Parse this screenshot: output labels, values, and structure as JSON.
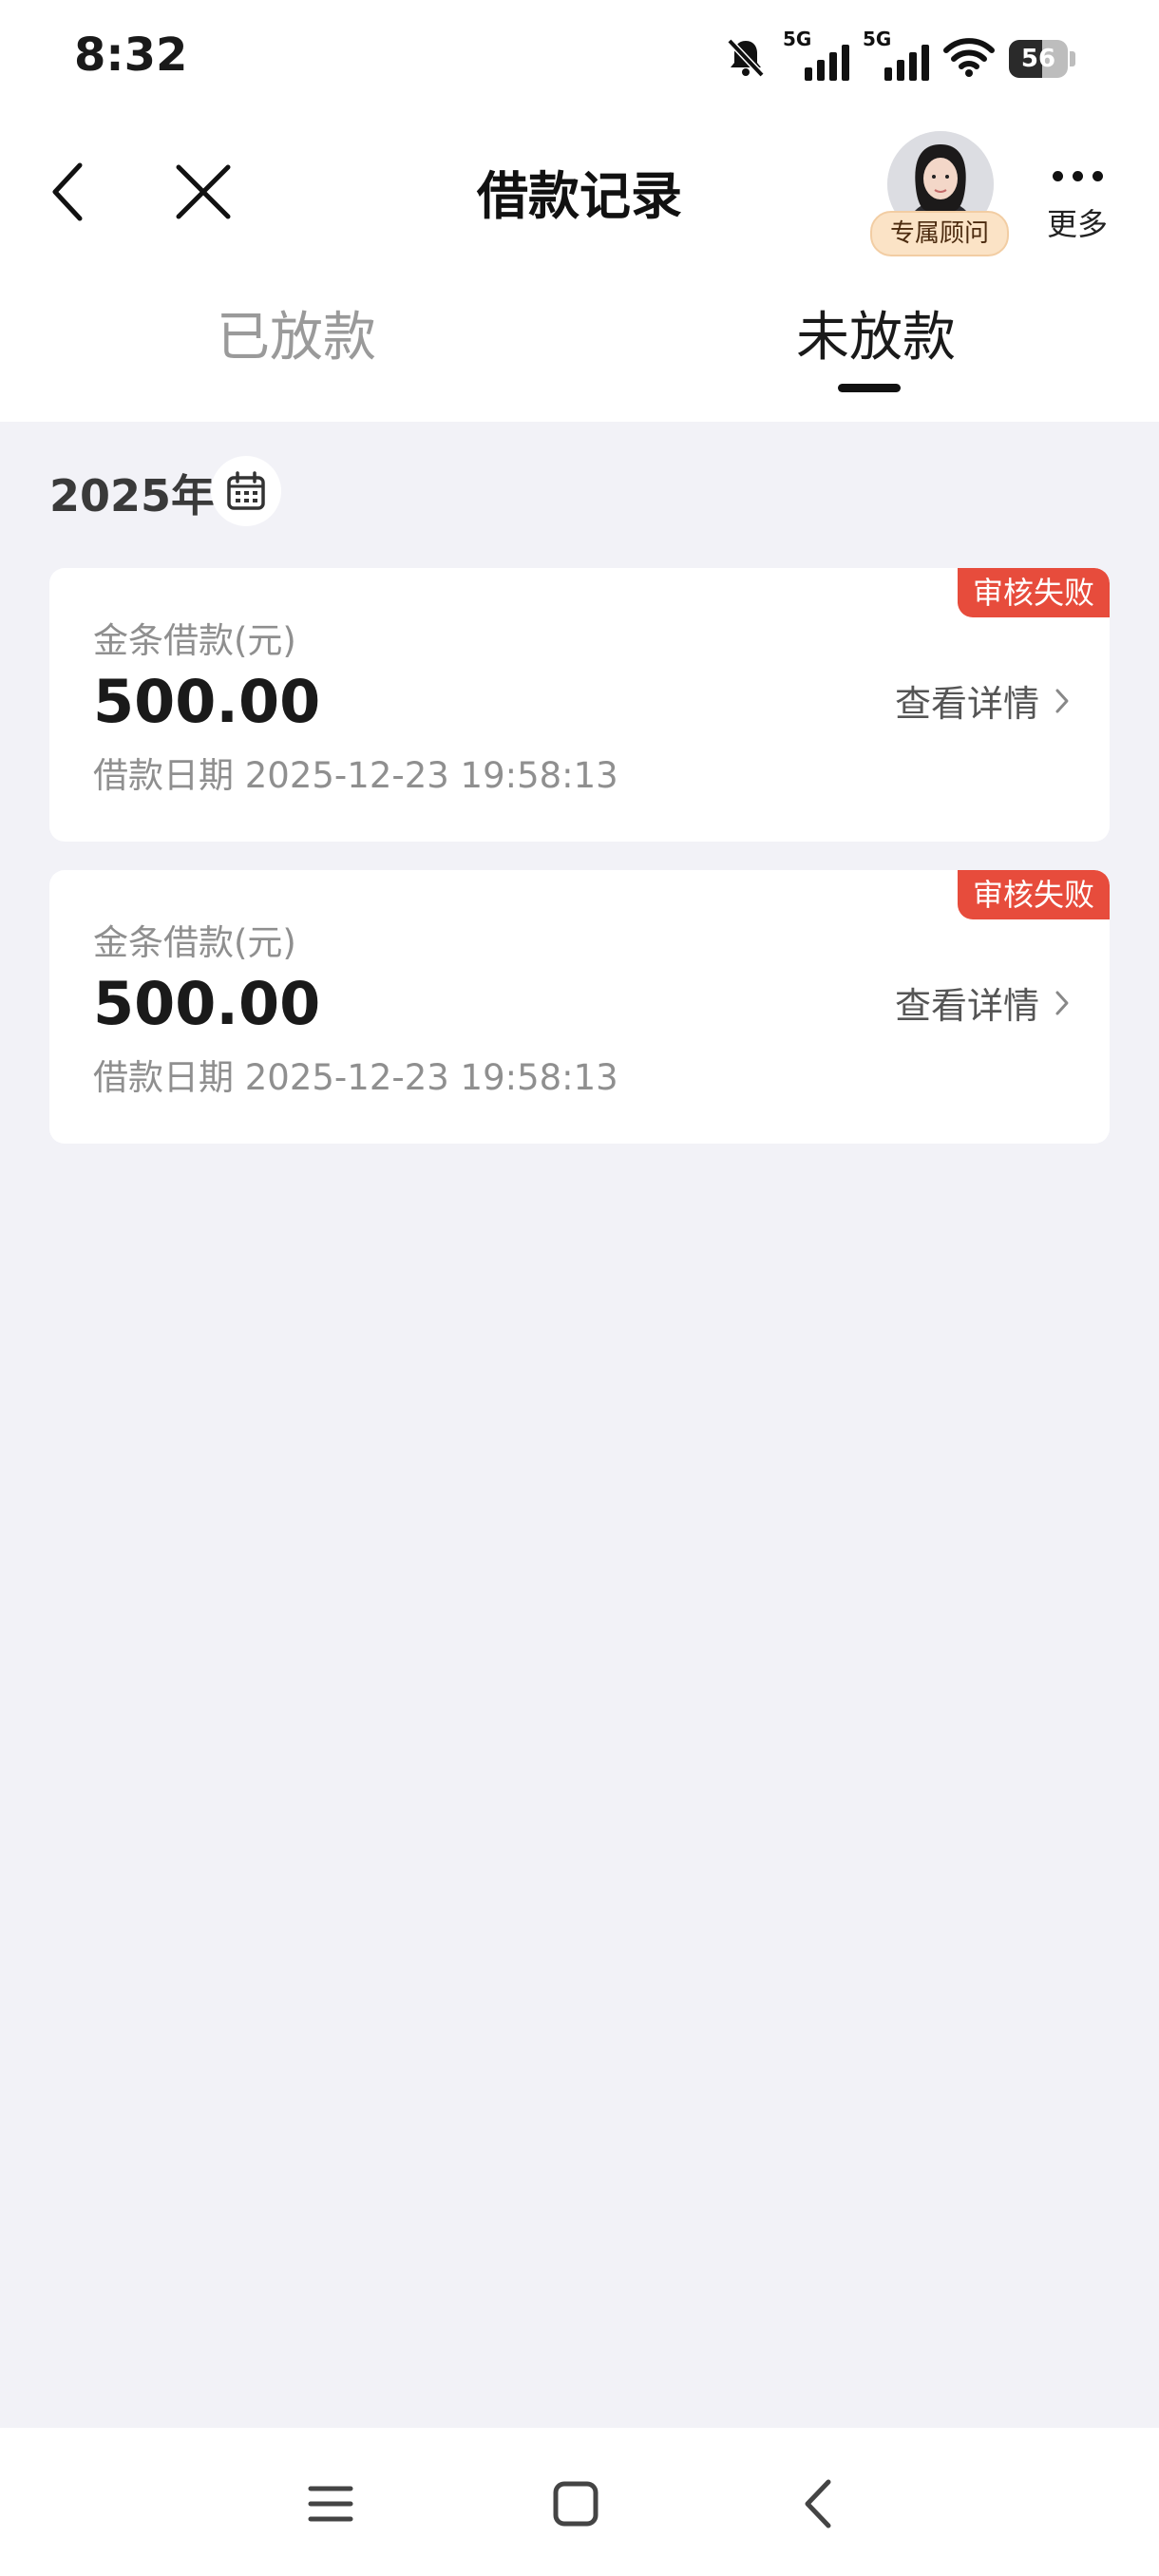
{
  "status_bar": {
    "time": "8:32",
    "signal1_label": "5G",
    "signal2_label": "5G",
    "battery_level": "56"
  },
  "nav": {
    "title": "借款记录",
    "advisor_label": "专属顾问",
    "more_label": "更多"
  },
  "tabs": [
    {
      "label": "已放款",
      "active": false
    },
    {
      "label": "未放款",
      "active": true
    }
  ],
  "year_label": "2025年",
  "records": [
    {
      "status": "审核失败",
      "label": "金条借款(元)",
      "amount": "500.00",
      "date": "借款日期 2025-12-23 19:58:13",
      "detail_label": "查看详情"
    },
    {
      "status": "审核失败",
      "label": "金条借款(元)",
      "amount": "500.00",
      "date": "借款日期 2025-12-23 19:58:13",
      "detail_label": "查看详情"
    }
  ],
  "colors": {
    "accent_red": "#e74c3c",
    "background": "#f2f2f7"
  }
}
